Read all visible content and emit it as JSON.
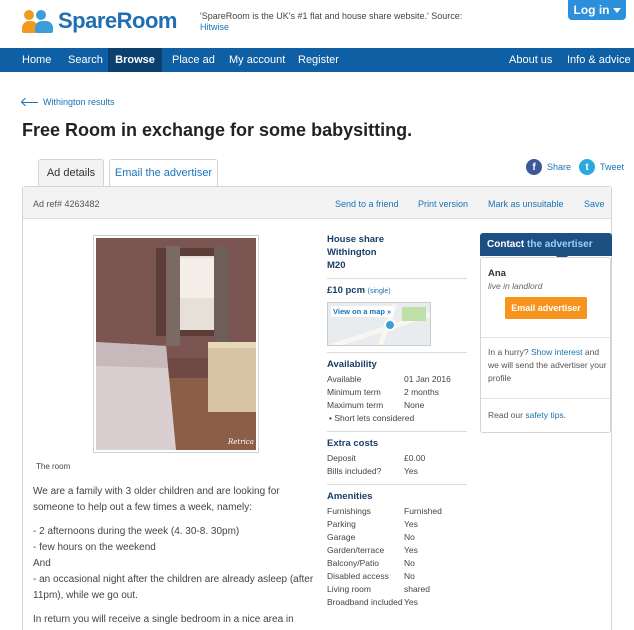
{
  "header": {
    "logo_text": "SpareRoom",
    "tagline": "'SpareRoom is the UK's #1 flat and house share website.' Source:",
    "tagline_source": "Hitwise",
    "login_label": "Log in"
  },
  "nav": {
    "items": [
      "Home",
      "Search",
      "Browse",
      "Place ad",
      "My account",
      "Register"
    ],
    "right_items": [
      "About us",
      "Info & advice"
    ],
    "active": "Browse"
  },
  "breadcrumb": "Withington results",
  "title": "Free Room in exchange for some babysitting.",
  "tabs": [
    "Ad details",
    "Email the advertiser"
  ],
  "share": {
    "facebook": "Share",
    "twitter": "Tweet"
  },
  "toolbar": {
    "ad_ref": "Ad ref# 4263482",
    "actions": [
      "Send to a friend",
      "Print version",
      "Mark as unsuitable",
      "Save"
    ]
  },
  "photo": {
    "caption": "The room",
    "watermark": "Retrica"
  },
  "description": [
    "We are a family with 3 older children and are looking for someone to help out a few times a week, namely:",
    "- 2 afternoons during the week (4. 30-8. 30pm)",
    "- few hours on the weekend",
    "And",
    "- an occasional night after the children are already asleep (after 11pm), while we go out.",
    "In return you will receive a single bedroom in a nice area in"
  ],
  "summary": {
    "type": "House share",
    "area": "Withington",
    "postcode": "M20",
    "price": "£10 pcm",
    "price_note": "(single)",
    "map_label": "View on a map »"
  },
  "availability": {
    "title": "Availability",
    "rows": [
      {
        "k": "Available",
        "v": "01 Jan 2016"
      },
      {
        "k": "Minimum term",
        "v": "2 months"
      },
      {
        "k": "Maximum term",
        "v": "None"
      }
    ],
    "bullet": "Short lets considered"
  },
  "extra_costs": {
    "title": "Extra costs",
    "rows": [
      {
        "k": "Deposit",
        "v": "£0.00"
      },
      {
        "k": "Bills included?",
        "v": "Yes"
      }
    ]
  },
  "amenities": {
    "title": "Amenities",
    "rows": [
      {
        "k": "Furnishings",
        "v": "Furnished"
      },
      {
        "k": "Parking",
        "v": "Yes"
      },
      {
        "k": "Garage",
        "v": "No"
      },
      {
        "k": "Garden/terrace",
        "v": "Yes"
      },
      {
        "k": "Balcony/Patio",
        "v": "No"
      },
      {
        "k": "Disabled access",
        "v": "No"
      },
      {
        "k": "Living room",
        "v": "shared"
      },
      {
        "k": "Broadband included",
        "v": "Yes"
      }
    ]
  },
  "contact": {
    "head_a": "Contact",
    "head_b": "the advertiser",
    "name": "Ana",
    "role": "live in landlord",
    "button": "Email advertiser",
    "hurry_a": "In a hurry?",
    "hurry_link": "Show interest",
    "hurry_b": "and we will send the advertiser your profile",
    "tips_a": "Read our",
    "tips_link": "safety tips",
    "tips_b": "."
  },
  "colors": {
    "nav": "#0f5fa4",
    "nav_active": "#0a3f70",
    "accent_orange": "#f7941d",
    "link": "#1a73b6"
  }
}
